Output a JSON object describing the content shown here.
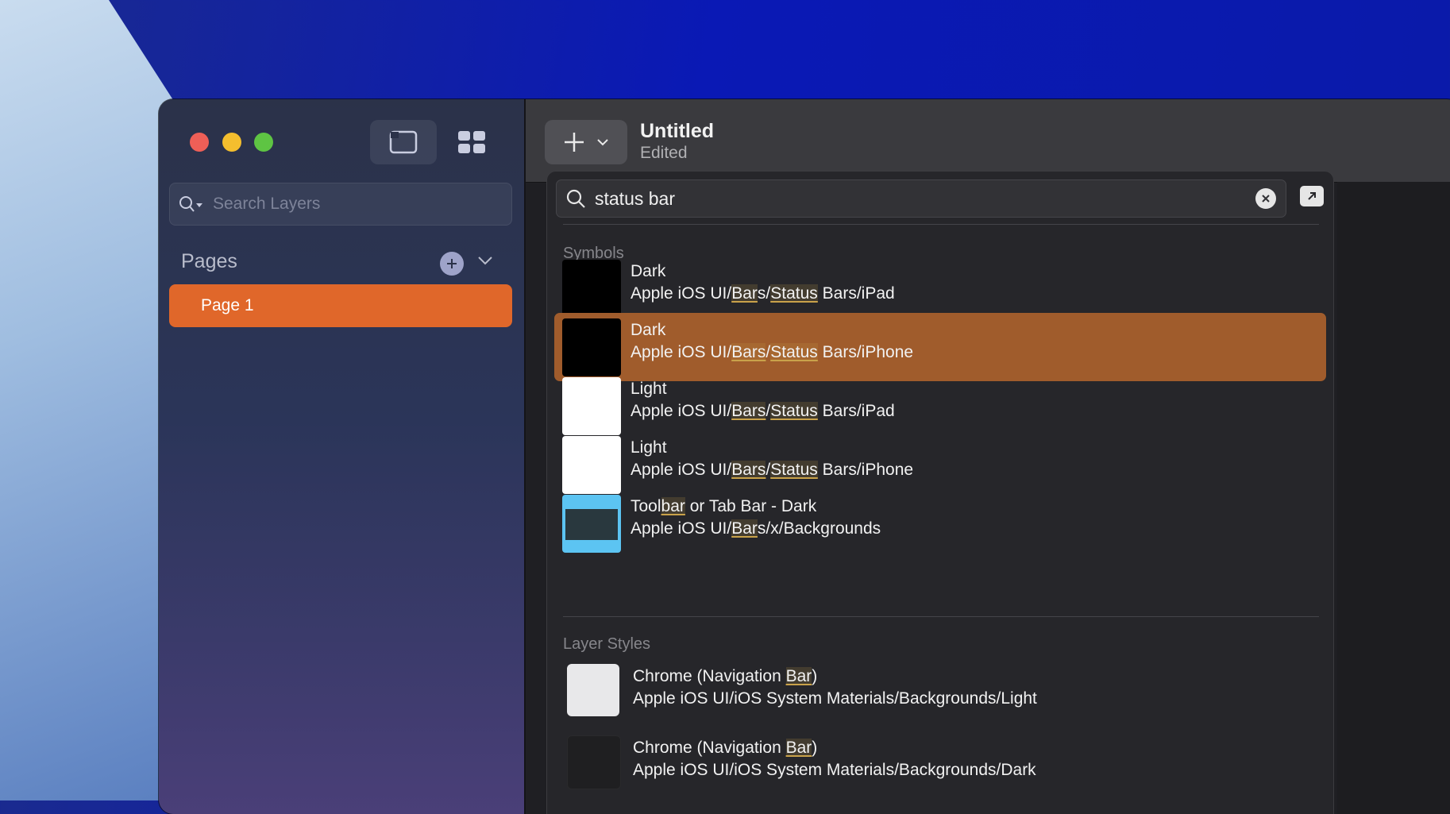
{
  "sidebar": {
    "search_placeholder": "Search Layers",
    "pages_title": "Pages",
    "pages": [
      {
        "label": "Page 1"
      }
    ]
  },
  "document": {
    "title": "Untitled",
    "status": "Edited"
  },
  "insert_popover": {
    "search_value": "status bar",
    "sections": {
      "symbols": {
        "label": "Symbols",
        "items": [
          {
            "name": [
              [
                "Dark",
                false
              ]
            ],
            "path": [
              [
                "Apple iOS UI/",
                false
              ],
              [
                "Bar",
                true
              ],
              [
                "s/",
                false
              ],
              [
                "Status",
                true
              ],
              [
                " Bars/iPad",
                false
              ]
            ],
            "thumb": "dark"
          },
          {
            "name": [
              [
                "Dark",
                false
              ]
            ],
            "path": [
              [
                "Apple iOS UI/",
                false
              ],
              [
                "Bars",
                true
              ],
              [
                "/",
                false
              ],
              [
                "Status",
                true
              ],
              [
                " Bars/iPhone",
                false
              ]
            ],
            "thumb": "dark",
            "selected": true
          },
          {
            "name": [
              [
                "Light",
                false
              ]
            ],
            "path": [
              [
                "Apple iOS UI/",
                false
              ],
              [
                "Bars",
                true
              ],
              [
                "/",
                false
              ],
              [
                "Status",
                true
              ],
              [
                " Bars/iPad",
                false
              ]
            ],
            "thumb": "light"
          },
          {
            "name": [
              [
                "Light",
                false
              ]
            ],
            "path": [
              [
                "Apple iOS UI/",
                false
              ],
              [
                "Bars",
                true
              ],
              [
                "/",
                false
              ],
              [
                "Status",
                true
              ],
              [
                " Bars/iPhone",
                false
              ]
            ],
            "thumb": "light"
          },
          {
            "name": [
              [
                "Tool",
                false
              ],
              [
                "bar",
                true
              ],
              [
                " or Tab Bar - Dark",
                false
              ]
            ],
            "path": [
              [
                "Apple iOS UI/",
                false
              ],
              [
                "Bar",
                true
              ],
              [
                "s/x/Backgrounds",
                false
              ]
            ],
            "thumb": "blue"
          }
        ]
      },
      "layer_styles": {
        "label": "Layer Styles",
        "items": [
          {
            "name": [
              [
                "Chrome (Navigation ",
                false
              ],
              [
                "Bar",
                true
              ],
              [
                ")",
                false
              ]
            ],
            "path": [
              [
                "Apple iOS UI/iOS System Materials/Backgrounds/Light",
                false
              ]
            ],
            "thumb": "ls-light"
          },
          {
            "name": [
              [
                "Chrome (Navigation ",
                false
              ],
              [
                "Bar",
                true
              ],
              [
                ")",
                false
              ]
            ],
            "path": [
              [
                "Apple iOS UI/iOS System Materials/Backgrounds/Dark",
                false
              ]
            ],
            "thumb": "ls-dark"
          }
        ]
      }
    }
  },
  "colors": {
    "accent": "#e0672a",
    "selected_row": "#a05c2c"
  },
  "icons": [
    "close-window-icon",
    "minimize-icon",
    "zoom-icon",
    "canvas-view-icon",
    "grid-view-icon",
    "search-icon",
    "add-page-icon",
    "chevron-down-icon",
    "plus-icon",
    "clear-icon",
    "expand-icon"
  ]
}
